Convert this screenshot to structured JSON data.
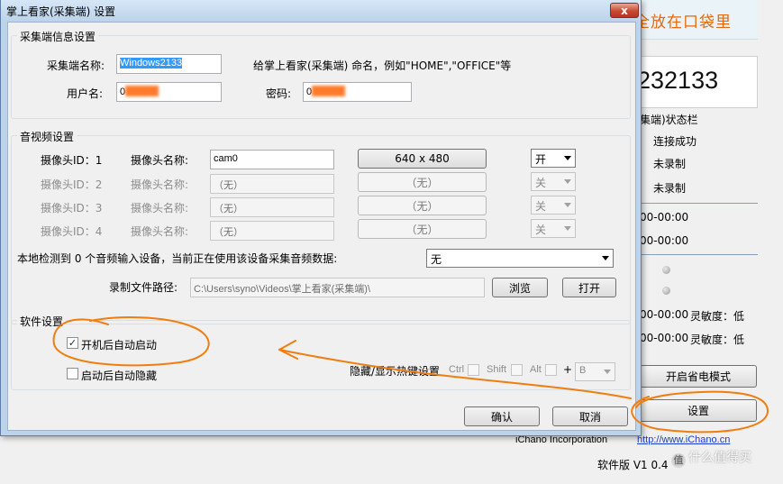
{
  "background_window": {
    "banner_text": "全放在口袋里",
    "device_id": "232133",
    "status_title": "集端)状态栏",
    "status_lines": [
      "连接成功",
      "未录制",
      "未录制"
    ],
    "schedule": [
      "00-00:00",
      "00-00:00",
      "00-00:00",
      "00-00:00"
    ],
    "sensitivity_labels": [
      "灵敏度：低",
      "灵敏度：低"
    ],
    "power_save_button": "开启省电模式",
    "settings_button": "设置",
    "company": "iChano Incorporation",
    "website": "http://www.iChano.cn",
    "version_text": "软件版 V1 0.4",
    "watermark": "什么值得买"
  },
  "dialog": {
    "title": "掌上看家(采集端) 设置",
    "close_label": "x",
    "info_group": {
      "title": "采集端信息设置",
      "name_label": "采集端名称:",
      "name_value": "Windows2133",
      "name_hint": "给掌上看家(采集端) 命名，例如\"HOME\",\"OFFICE\"等",
      "user_label": "用户名:",
      "password_label": "密码:",
      "user_value_prefix": "0",
      "password_value_prefix": "0"
    },
    "av_group": {
      "title": "音视频设置",
      "cameras": [
        {
          "id_label": "摄像头ID：1",
          "name_label": "摄像头名称:",
          "name_value": "cam0",
          "resolution": "640 x 480",
          "switch": "开"
        },
        {
          "id_label": "摄像头ID：2",
          "name_label": "摄像头名称:",
          "name_value": "（无）",
          "resolution": "（无）",
          "switch": "关"
        },
        {
          "id_label": "摄像头ID：3",
          "name_label": "摄像头名称:",
          "name_value": "（无）",
          "resolution": "（无）",
          "switch": "关"
        },
        {
          "id_label": "摄像头ID：4",
          "name_label": "摄像头名称:",
          "name_value": "（无）",
          "resolution": "（无）",
          "switch": "关"
        }
      ],
      "audio_text": "本地检测到 0 个音频输入设备，当前正在使用该设备采集音频数据:",
      "audio_value": "无",
      "record_path_label": "录制文件路径:",
      "record_path_value": "C:\\Users\\syno\\Videos\\掌上看家(采集端)\\",
      "browse_button": "浏览",
      "open_button": "打开"
    },
    "software_group": {
      "title": "软件设置",
      "auto_start_label": "开机后自动启动",
      "auto_start_checked": true,
      "auto_hide_label": "启动后自动隐藏",
      "auto_hide_checked": false,
      "hotkey_label": "隐藏/显示热键设置",
      "ctrl_label": "Ctrl",
      "shift_label": "Shift",
      "alt_label": "Alt",
      "plus_label": "+",
      "key_value": "B"
    },
    "ok_button": "确认",
    "cancel_button": "取消"
  },
  "annotation_color": "#f07d0f"
}
